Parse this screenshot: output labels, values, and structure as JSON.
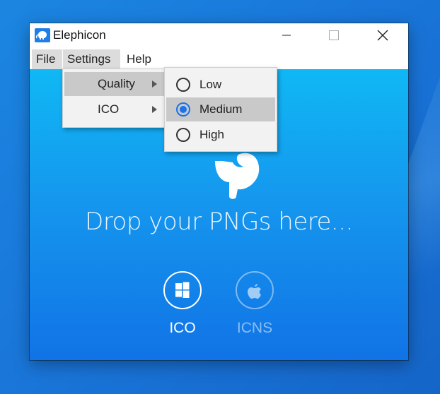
{
  "window": {
    "title": "Elephicon"
  },
  "menubar": {
    "file": "File",
    "settings": "Settings",
    "help": "Help"
  },
  "settings_menu": {
    "items": [
      {
        "label": "Quality",
        "highlighted": true
      },
      {
        "label": "ICO",
        "highlighted": false
      }
    ]
  },
  "quality_menu": {
    "options": [
      {
        "label": "Low",
        "selected": false
      },
      {
        "label": "Medium",
        "selected": true
      },
      {
        "label": "High",
        "selected": false
      }
    ]
  },
  "main": {
    "drop_text": "Drop your PNGs here...",
    "formats": [
      {
        "label": "ICO",
        "icon": "windows-icon",
        "active": true
      },
      {
        "label": "ICNS",
        "icon": "apple-icon",
        "active": false
      }
    ]
  },
  "colors": {
    "accent": "#1a73e8",
    "content_top": "#10b8f4",
    "content_bottom": "#1173e6"
  }
}
